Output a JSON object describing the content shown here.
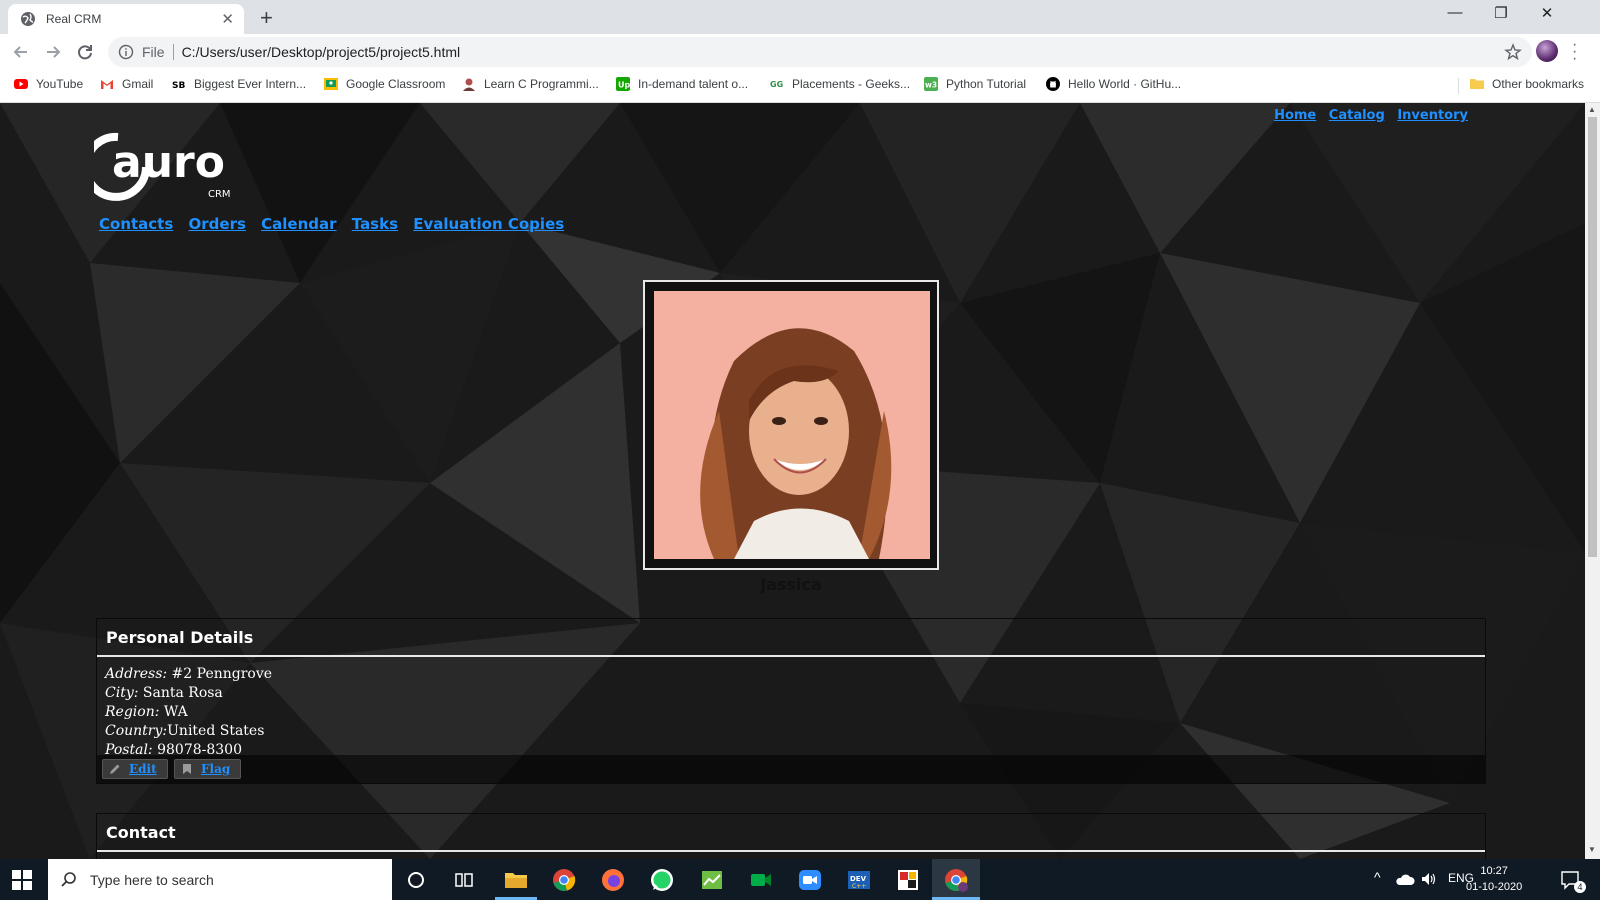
{
  "browser": {
    "tab_title": "Real CRM",
    "tab_close": "✕",
    "new_tab": "+",
    "address_prefix": "File",
    "url": "C:/Users/user/Desktop/project5/project5.html",
    "window_controls": [
      "—",
      "❐",
      "✕"
    ],
    "bookmarks": [
      {
        "label": "YouTube",
        "icon": "youtube-icon",
        "color": "#ff0000"
      },
      {
        "label": "Gmail",
        "icon": "gmail-icon",
        "color": "#ea4335"
      },
      {
        "label": "Biggest Ever Intern...",
        "icon": "sb-icon",
        "color": "#000000"
      },
      {
        "label": "Google Classroom",
        "icon": "classroom-icon",
        "color": "#f9bc00"
      },
      {
        "label": "Learn C Programmi...",
        "icon": "avatar-icon",
        "color": "#b14d4d"
      },
      {
        "label": "In-demand talent o...",
        "icon": "upwork-icon",
        "color": "#14a800"
      },
      {
        "label": "Placements - Geeks...",
        "icon": "gfg-icon",
        "color": "#2f8d46"
      },
      {
        "label": "Python Tutorial",
        "icon": "w3-icon",
        "color": "#4caf50"
      },
      {
        "label": "Hello World · GitHu...",
        "icon": "github-icon",
        "color": "#000000"
      }
    ],
    "other_bookmarks": "Other bookmarks"
  },
  "page": {
    "top_links": [
      "Home",
      "Catalog",
      "Inventory"
    ],
    "logo_text": "auro",
    "logo_sub": "CRM",
    "nav": [
      "Contacts",
      "Orders",
      "Calendar",
      "Tasks",
      "Evaluation Copies"
    ],
    "profile_name": "Jassica",
    "personal": {
      "heading": "Personal Details",
      "address_label": "Address:",
      "address": " #2 Penngrove",
      "city_label": "City:",
      "city": " Santa Rosa",
      "region_label": "Region:",
      "region": " WA",
      "country_label": "Country:",
      "country": "United States",
      "postal_label": "Postal:",
      "postal": " 98078-8300",
      "edit_label": "Edit",
      "flag_label": "Flag"
    },
    "contact": {
      "heading": "Contact"
    },
    "colors": {
      "link": "#1e90ff",
      "background": "#161616"
    }
  },
  "taskbar": {
    "search_placeholder": "Type here to search",
    "language": "ENG",
    "time": "10:27",
    "date": "01-10-2020",
    "notifications": "4"
  }
}
